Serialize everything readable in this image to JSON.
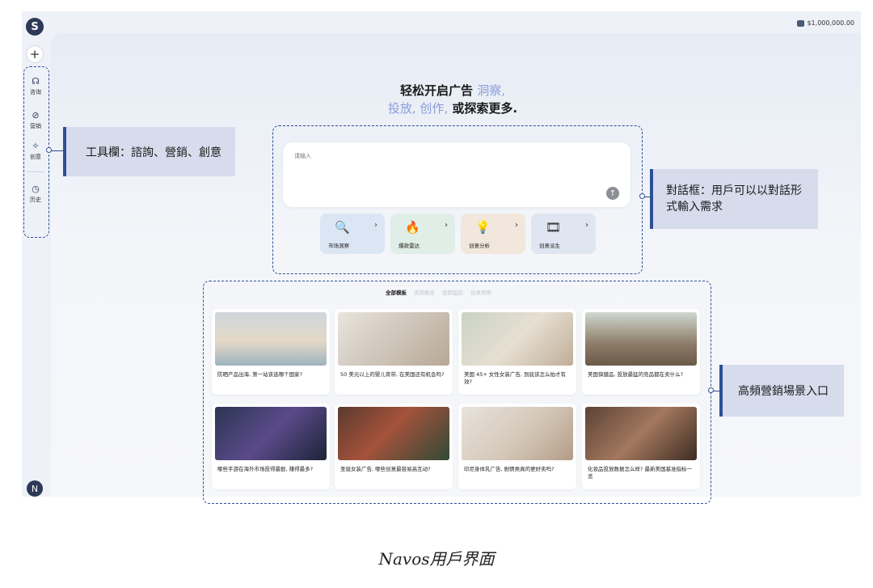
{
  "balance": "$1,000,000.00",
  "sidebar": {
    "logo": "S",
    "new_button": "+",
    "items": [
      {
        "label": "咨询",
        "icon": "chat-icon"
      },
      {
        "label": "营销",
        "icon": "compass-icon"
      },
      {
        "label": "创意",
        "icon": "sparkle-icon"
      },
      {
        "label": "历史",
        "icon": "clock-icon"
      }
    ],
    "avatar": "N"
  },
  "headline": {
    "line1_prefix": "轻松开启广告",
    "line1_accent": "洞察,",
    "line2_accent": "投放, 创作,",
    "line2_suffix": "或探索更多."
  },
  "chat": {
    "placeholder": "请输入",
    "send": "↑"
  },
  "quick_actions": [
    {
      "label": "市场洞察",
      "icon": "magnifier-icon",
      "color": "#dbe6f5"
    },
    {
      "label": "爆款雷达",
      "icon": "fire-icon",
      "color": "#dfeee6"
    },
    {
      "label": "创意分析",
      "icon": "bulb-icon",
      "color": "#f1e7dc"
    },
    {
      "label": "创意派生",
      "icon": "film-icon",
      "color": "#dfe6f1"
    }
  ],
  "template_tabs": [
    "全部模板",
    "咨询报告",
    "营销监控",
    "创意洞察"
  ],
  "templates": [
    {
      "caption": "防晒产品出海, 第一站该选哪个国家?"
    },
    {
      "caption": "50 美元以上的婴儿背带, 在美国还有机会吗?"
    },
    {
      "caption": "美国 45+ 女性女装广告, 到底该怎么拍才有效?"
    },
    {
      "caption": "美国保健品, 投放最猛的竞品都在卖什么?"
    },
    {
      "caption": "哪些手游在海外市场投得最狠, 赚得最多?"
    },
    {
      "caption": "圣诞女装广告, 哪些创意最容易高互动?"
    },
    {
      "caption": "印尼身体乳广告, 剧情类真的更好卖吗?"
    },
    {
      "caption": "化妆品投放数据怎么样? 最新美国基准指标一览"
    }
  ],
  "annotations": {
    "toolbar": "工具欄：諮詢、營銷、創意",
    "dialog": "對話框：用戶可以以對話形式輸入需求",
    "scenes": "高頻營銷場景入口"
  },
  "figure_caption": "Navos用戶界面"
}
